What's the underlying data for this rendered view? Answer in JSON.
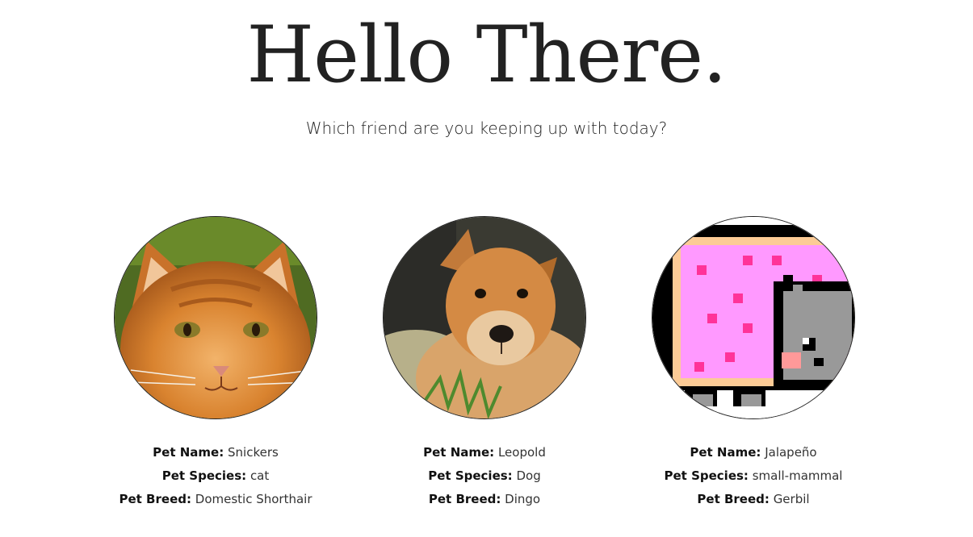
{
  "header": {
    "title": "Hello There.",
    "subtitle": "Which friend are you keeping up with today?"
  },
  "labels": {
    "name": "Pet Name:",
    "species": "Pet Species:",
    "breed": "Pet Breed:"
  },
  "pets": [
    {
      "name": "Snickers",
      "species": "cat",
      "breed": "Domestic Shorthair",
      "image": "orange-tabby-cat-photo"
    },
    {
      "name": "Leopold",
      "species": "Dog",
      "breed": "Dingo",
      "image": "puppy-photo"
    },
    {
      "name": "Jalapeño",
      "species": "small-mammal",
      "breed": "Gerbil",
      "image": "pixel-nyan-cat-art"
    }
  ]
}
